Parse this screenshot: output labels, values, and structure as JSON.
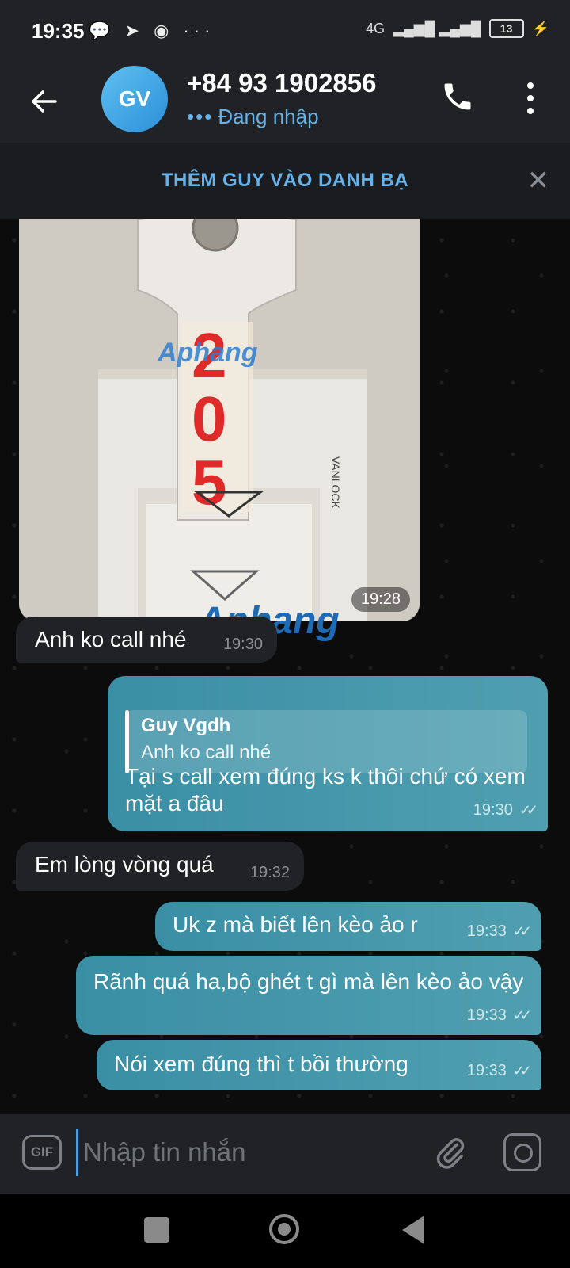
{
  "status_bar": {
    "time": "19:35",
    "notification_icons": [
      "chat-bubble-icon",
      "telegram-icon",
      "messenger-icon",
      "more-dots-icon"
    ],
    "network": "4G",
    "battery": "13"
  },
  "header": {
    "avatar_initials": "GV",
    "contact_name": "+84 93 1902856",
    "status": "Đang nhập",
    "status_dots": "•••"
  },
  "banner": {
    "text": "THÊM GUY VÀO DANH BẠ",
    "close": "✕"
  },
  "photo": {
    "time": "19:28",
    "watermark": "Aphang"
  },
  "messages": [
    {
      "dir": "in",
      "text": "Anh ko call nhé",
      "time": "19:30"
    },
    {
      "dir": "out",
      "reply_name": "Guy Vgdh",
      "reply_text": "Anh ko call nhé",
      "text": "Tại s call xem đúng ks k thôi chứ có xem mặt a đâu",
      "time": "19:30",
      "ticks": "✓✓"
    },
    {
      "dir": "in",
      "text": "Em lòng vòng quá",
      "time": "19:32"
    },
    {
      "dir": "out",
      "text": "Uk z mà biết lên kèo ảo r",
      "time": "19:33",
      "ticks": "✓✓"
    },
    {
      "dir": "out",
      "text": "Rãnh quá ha,bộ ghét t gì mà lên kèo ảo vậy",
      "time": "19:33",
      "ticks": "✓✓"
    },
    {
      "dir": "out",
      "text": "Nói xem đúng thì t bồi thường",
      "time": "19:33",
      "ticks": "✓✓"
    }
  ],
  "overlay_watermark": "Aphang",
  "composer": {
    "gif_label": "GIF",
    "placeholder": "Nhập tin nhắn"
  },
  "colors": {
    "accent": "#66b2e8",
    "outgoing_bubble": "#4a9aad",
    "incoming_bubble": "#212225"
  }
}
